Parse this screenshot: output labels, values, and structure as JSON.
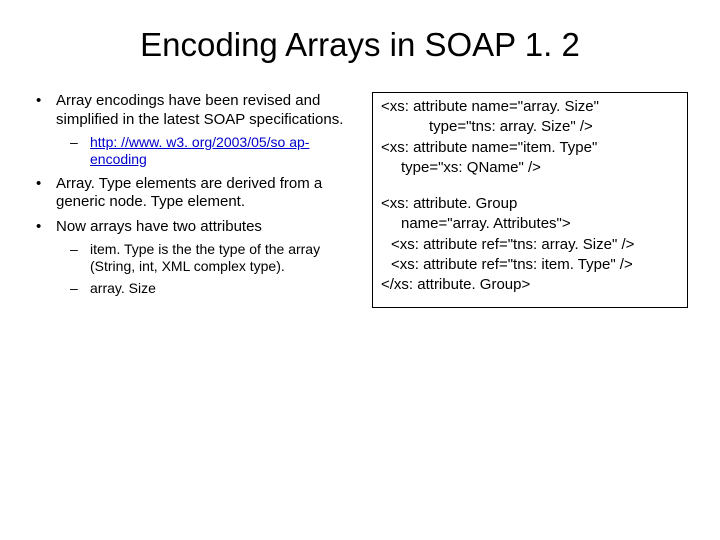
{
  "title": "Encoding Arrays in SOAP 1. 2",
  "left": {
    "item1": "Array encodings have been revised and simplified in the latest SOAP specifications.",
    "item1_link": "http: //www. w3. org/2003/05/so ap-encoding",
    "item2": "Array. Type elements are derived from a generic node. Type element.",
    "item3": "Now arrays have two attributes",
    "item3_sub1": "item. Type is the the type of the array (String, int, XML complex type).",
    "item3_sub2": "array. Size"
  },
  "right": {
    "l1": "<xs: attribute name=\"array. Size\"",
    "l2": "type=\"tns: array. Size\" />",
    "l3": "<xs: attribute name=\"item. Type\"",
    "l4": "type=\"xs: QName\" />",
    "l5": "<xs: attribute. Group",
    "l6": "name=\"array. Attributes\">",
    "l7": "<xs: attribute ref=\"tns: array. Size\" />",
    "l8": "<xs: attribute ref=\"tns: item. Type\" />",
    "l9": "</xs: attribute. Group>"
  }
}
